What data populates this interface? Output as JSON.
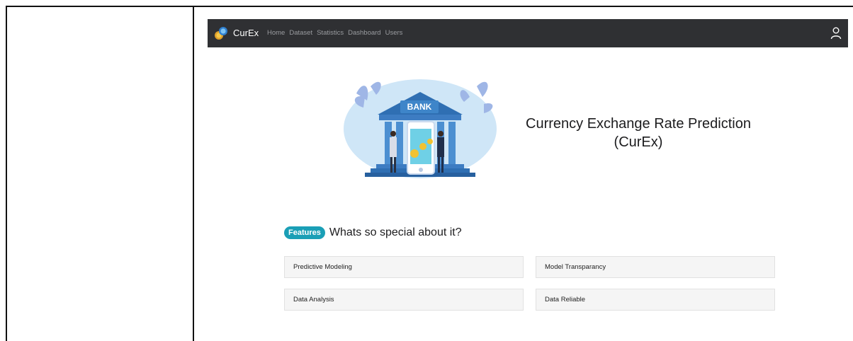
{
  "navbar": {
    "brand": "CurEx",
    "links": [
      "Home",
      "Dataset",
      "Statistics",
      "Dashboard",
      "Users"
    ]
  },
  "hero": {
    "title": "Currency Exchange Rate Prediction (CurEx)",
    "illustration_label": "BANK"
  },
  "features": {
    "badge": "Features",
    "subtitle": "Whats so special about it?",
    "items": [
      "Predictive Modeling",
      "Model Transparancy",
      "Data Analysis",
      "Data Reliable"
    ]
  },
  "colors": {
    "navbar_bg": "#2f3033",
    "accent": "#1a9fb6",
    "card_bg": "#f5f5f5"
  }
}
